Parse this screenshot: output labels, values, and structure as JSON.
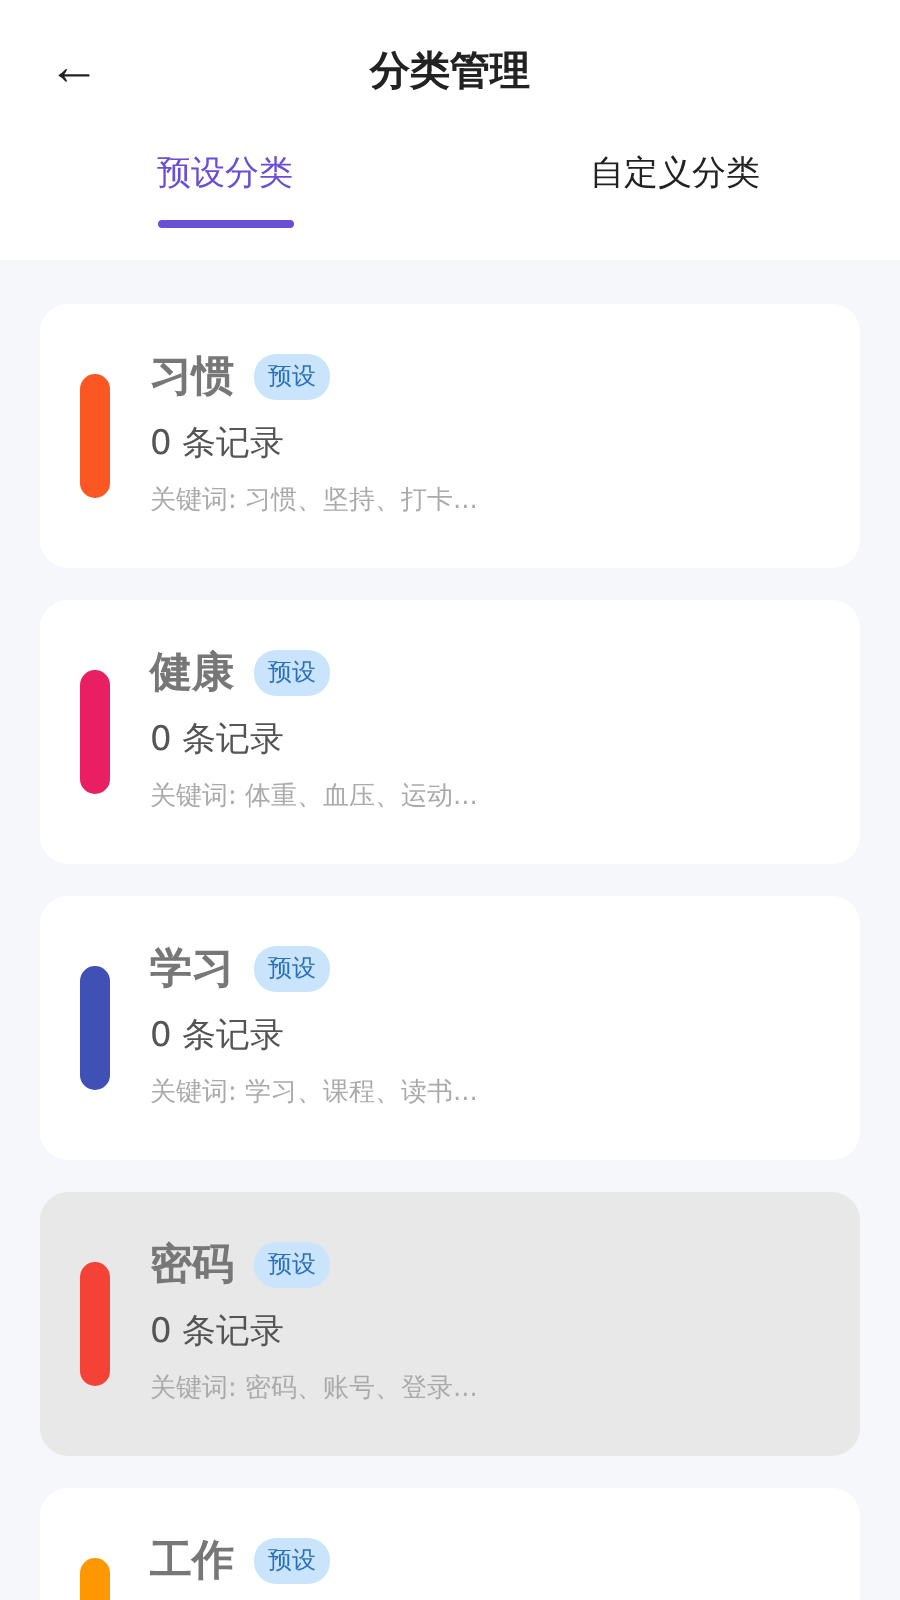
{
  "header": {
    "back": "←",
    "title": "分类管理"
  },
  "tabs": [
    {
      "label": "预设分类",
      "selected": true
    },
    {
      "label": "自定义分类",
      "selected": false
    }
  ],
  "categories": [
    {
      "name": "习惯",
      "badge": "预设",
      "count": "0 条记录",
      "keywords": "关键词: 习惯、坚持、打卡...",
      "color": "#fb5722",
      "selected": false
    },
    {
      "name": "健康",
      "badge": "预设",
      "count": "0 条记录",
      "keywords": "关键词: 体重、血压、运动...",
      "color": "#e91e63",
      "selected": false
    },
    {
      "name": "学习",
      "badge": "预设",
      "count": "0 条记录",
      "keywords": "关键词: 学习、课程、读书...",
      "color": "#3f51b5",
      "selected": false
    },
    {
      "name": "密码",
      "badge": "预设",
      "count": "0 条记录",
      "keywords": "关键词: 密码、账号、登录...",
      "color": "#f44336",
      "selected": true
    },
    {
      "name": "工作",
      "badge": "预设",
      "color": "#ff9800",
      "selected": false
    }
  ]
}
